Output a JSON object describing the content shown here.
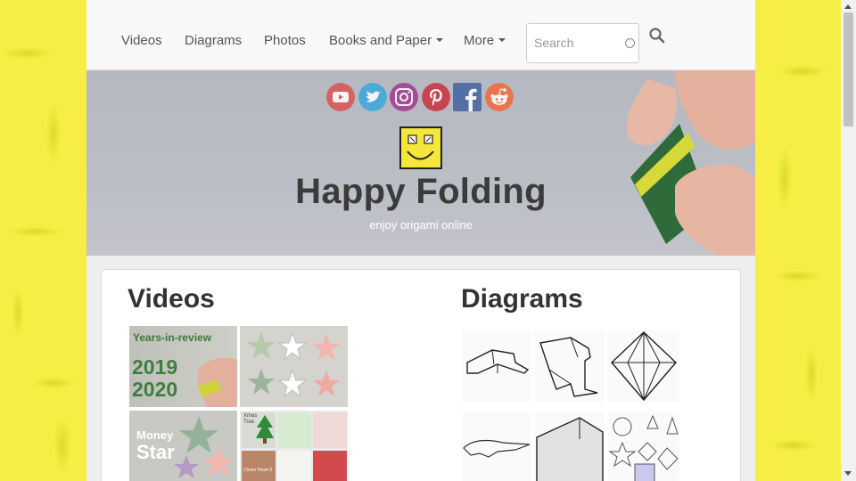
{
  "nav": {
    "items": [
      {
        "label": "Videos"
      },
      {
        "label": "Diagrams"
      },
      {
        "label": "Photos"
      },
      {
        "label": "Books and Paper"
      },
      {
        "label": "More"
      }
    ],
    "search_placeholder": "Search"
  },
  "hero": {
    "title": "Happy Folding",
    "subtitle": "enjoy origami online",
    "social_icons": [
      "youtube-icon",
      "twitter-icon",
      "instagram-icon",
      "pinterest-icon",
      "facebook-icon",
      "reddit-icon"
    ]
  },
  "main": {
    "videos_heading": "Videos",
    "diagrams_heading": "Diagrams",
    "video_thumbs": [
      {
        "line1": "Years-in-review",
        "line2": "2019",
        "line3": "2020"
      },
      {
        "line1": ""
      },
      {
        "line1": "Money",
        "line2": "Star"
      },
      {
        "line1": "Xmas",
        "line2": "Tree",
        "line3": "Clover Heart 2"
      }
    ]
  },
  "colors": {
    "accent_yellow": "#f5e63b",
    "youtube": "#e53935",
    "twitter": "#29a9e1",
    "instagram": "#b83a8e",
    "pinterest": "#cb2027",
    "facebook": "#3b5998",
    "reddit": "#ff5700"
  }
}
